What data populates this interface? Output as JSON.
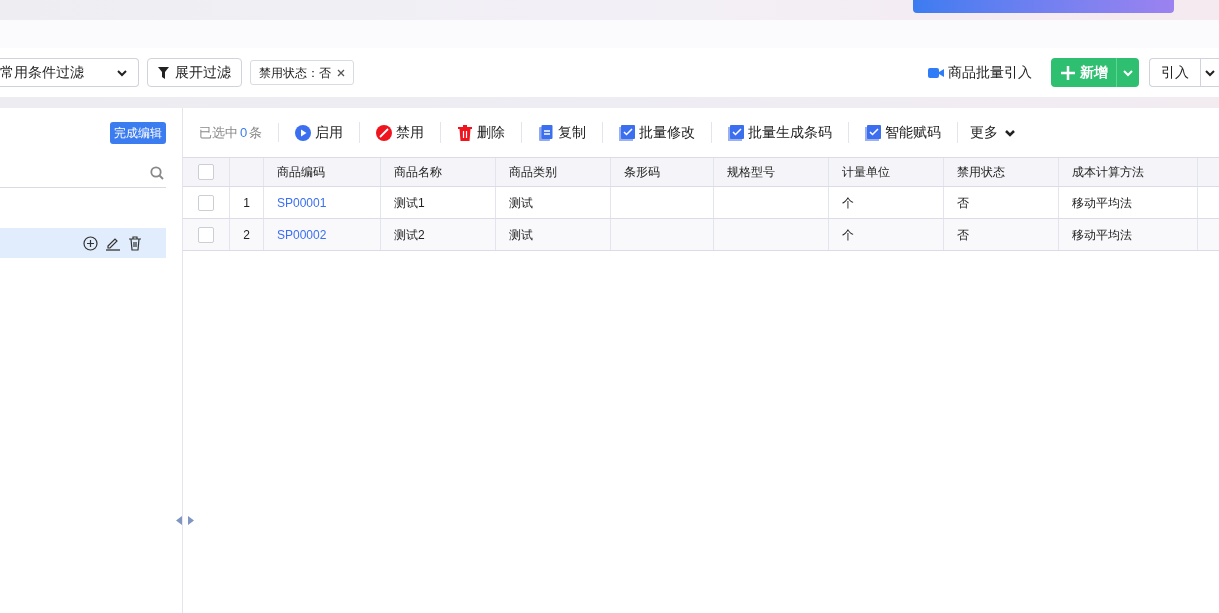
{
  "filter_bar": {
    "scheme_dropdown": "常用条件过滤",
    "expand_filter": "展开过滤",
    "filter_tags": [
      {
        "label": "禁用状态：否"
      }
    ],
    "batch_import": "商品批量引入",
    "add_button": "新增",
    "import_button": "引入"
  },
  "left_panel": {
    "finish_edit": "完成编辑",
    "tree_items": [
      {
        "selected": true
      }
    ]
  },
  "toolbar": {
    "selected_count_prefix": "已选中",
    "selected_count": "0",
    "selected_count_suffix": "条",
    "actions": [
      {
        "label": "启用",
        "kind": "enable"
      },
      {
        "label": "禁用",
        "kind": "disable"
      },
      {
        "label": "删除",
        "kind": "delete"
      },
      {
        "label": "复制",
        "kind": "copy"
      },
      {
        "label": "批量修改",
        "kind": "check"
      },
      {
        "label": "批量生成条码",
        "kind": "check"
      },
      {
        "label": "智能赋码",
        "kind": "check"
      },
      {
        "label": "更多",
        "kind": "more"
      }
    ]
  },
  "table": {
    "select_all_checked": false,
    "columns": [
      "商品编码",
      "商品名称",
      "商品类别",
      "条形码",
      "规格型号",
      "计量单位",
      "禁用状态",
      "成本计算方法"
    ],
    "rows": [
      {
        "checked": false,
        "index": "1",
        "cells": [
          "SP00001",
          "测试1",
          "测试",
          "",
          "",
          "个",
          "否",
          "移动平均法"
        ]
      },
      {
        "checked": false,
        "index": "2",
        "cells": [
          "SP00002",
          "测试2",
          "测试",
          "",
          "",
          "个",
          "否",
          "移动平均法"
        ]
      }
    ]
  }
}
